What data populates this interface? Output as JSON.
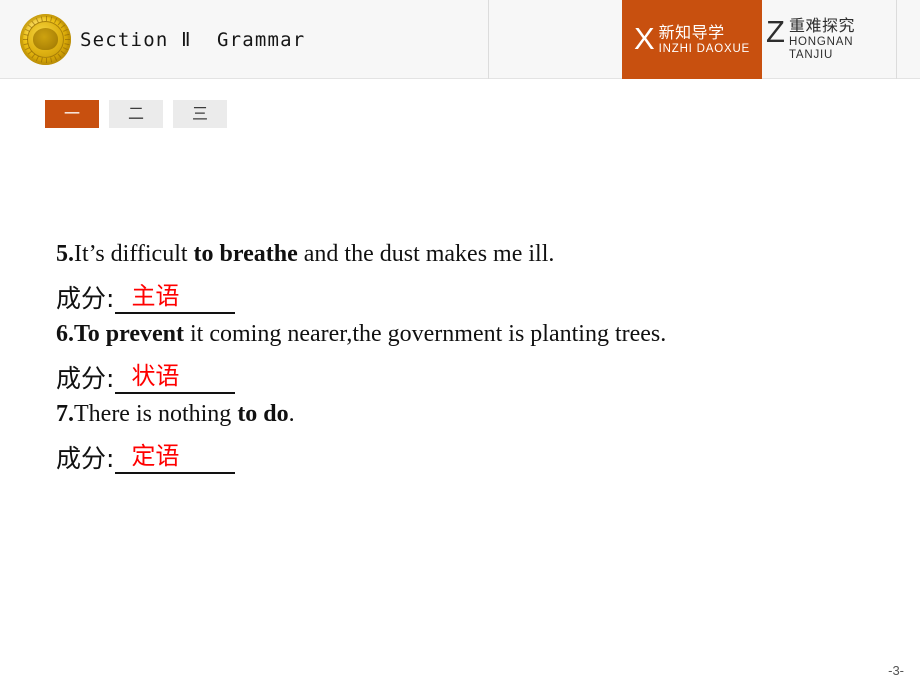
{
  "header": {
    "logo_icon": "gold-coin-medallion-icon",
    "title": "Section Ⅱ  Grammar",
    "badges": [
      {
        "letter": "X",
        "cn": "新知导学",
        "en": "INZHI DAOXUE",
        "active": true,
        "bg_color": "#c8500f",
        "text_color": "#ffffff"
      },
      {
        "letter": "Z",
        "cn": "重难探究",
        "en": "HONGNAN TANJIU",
        "active": false,
        "bg_color": "#f7f7f7",
        "text_color": "#2e2e2e"
      }
    ]
  },
  "tabs": [
    {
      "label": "一",
      "active": true
    },
    {
      "label": "二",
      "active": false
    },
    {
      "label": "三",
      "active": false
    }
  ],
  "exercises": [
    {
      "number": "5.",
      "before": "It’s difficult ",
      "bold": "to breathe",
      "after": " and the dust makes me ill.",
      "answer_label": "成分:",
      "answer": "主语"
    },
    {
      "number": "6.",
      "before": "",
      "bold": "To prevent",
      "after": " it coming nearer,the government is planting trees.",
      "answer_label": "成分:",
      "answer": "状语"
    },
    {
      "number": "7.",
      "before": "There is nothing ",
      "bold": "to do",
      "after": ".",
      "answer_label": "成分:",
      "answer": "定语"
    }
  ],
  "footer": {
    "page_number": "-3-"
  },
  "colors": {
    "accent_orange": "#c8500f",
    "answer_red": "#ff0000",
    "header_bg": "#f7f7f7",
    "tab_inactive_bg": "#ebebeb"
  }
}
